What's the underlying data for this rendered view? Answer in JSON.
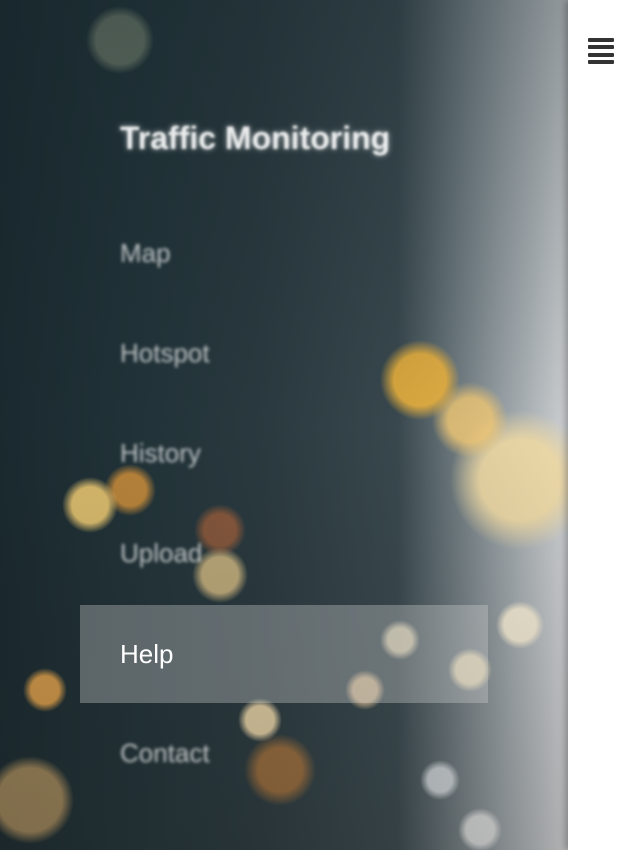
{
  "menu": {
    "title": "Traffic Monitoring",
    "items": [
      {
        "label": "Map"
      },
      {
        "label": "Hotspot"
      },
      {
        "label": "History"
      },
      {
        "label": "Upload"
      },
      {
        "label": "Help",
        "active": true
      },
      {
        "label": "Contact"
      }
    ]
  },
  "panel": {
    "icon": "hamburger-menu-icon"
  },
  "colors": {
    "panel_bg": "#ffffff",
    "active_item_bg": "#d2d2d2",
    "icon": "#333333"
  }
}
